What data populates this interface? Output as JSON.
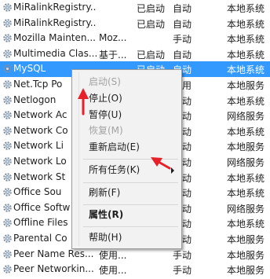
{
  "services": [
    {
      "name": "MiRalinkRegistry...",
      "desc": "",
      "status": "已启动",
      "startup": "自动",
      "logon": "本地系统"
    },
    {
      "name": "MiRalinkRegistry...",
      "desc": "",
      "status": "已启动",
      "startup": "自动",
      "logon": "本地系统"
    },
    {
      "name": "Mozilla Mainten...",
      "desc": "Moz...",
      "status": "",
      "startup": "手动",
      "logon": "本地系统"
    },
    {
      "name": "Multimedia Clas...",
      "desc": "基于...",
      "status": "已启动",
      "startup": "自动",
      "logon": "本地系统"
    },
    {
      "name": "MySQL",
      "desc": "",
      "status": "已启动",
      "startup": "自动",
      "logon": "本地系统",
      "selected": true
    },
    {
      "name": "Net.Tcp Po",
      "desc": "",
      "status": "",
      "startup": "禁用",
      "logon": "本地服务"
    },
    {
      "name": "Netlogon",
      "desc": "",
      "status": "",
      "startup": "手动",
      "logon": "本地系统"
    },
    {
      "name": "Network Ac",
      "desc": "",
      "status": "",
      "startup": "手动",
      "logon": "网络服务"
    },
    {
      "name": "Network Co",
      "desc": "",
      "status": "",
      "startup": "手动",
      "logon": "本地系统"
    },
    {
      "name": "Network Li",
      "desc": "",
      "status": "",
      "startup": "手动",
      "logon": "本地服务"
    },
    {
      "name": "Network Lo",
      "desc": "",
      "status": "",
      "startup": "自动",
      "logon": "网络服务"
    },
    {
      "name": "Network St",
      "desc": "",
      "status": "",
      "startup": "自动",
      "logon": "本地系统"
    },
    {
      "name": "Office  Sou",
      "desc": "",
      "status": "",
      "startup": "手动",
      "logon": "本地系统"
    },
    {
      "name": "Office Softw",
      "desc": "",
      "status": "",
      "startup": "自动",
      "logon": "网络服务"
    },
    {
      "name": "Offline Files",
      "desc": "",
      "status": "",
      "startup": "手动",
      "logon": "本地系统"
    },
    {
      "name": "Parental Co",
      "desc": "",
      "status": "",
      "startup": "手动",
      "logon": "本地服务"
    },
    {
      "name": "Peer Name Res...",
      "desc": "使用...",
      "status": "",
      "startup": "手动",
      "logon": "本地服务"
    },
    {
      "name": "Peer Networkin...",
      "desc": "使用...",
      "status": "",
      "startup": "手动",
      "logon": "本地服务"
    }
  ],
  "context_menu": {
    "start": "启动(S)",
    "stop": "停止(O)",
    "pause": "暂停(U)",
    "resume": "恢复(M)",
    "restart": "重新启动(E)",
    "all_tasks": "所有任务(K)",
    "refresh": "刷新(F)",
    "properties": "属性(R)",
    "help": "帮助(H)"
  },
  "colors": {
    "selection": "#3399ff",
    "annotation_arrow": "#e8202a"
  },
  "icons": {
    "service": "gear-icon",
    "submenu": "chevron-right-icon"
  }
}
